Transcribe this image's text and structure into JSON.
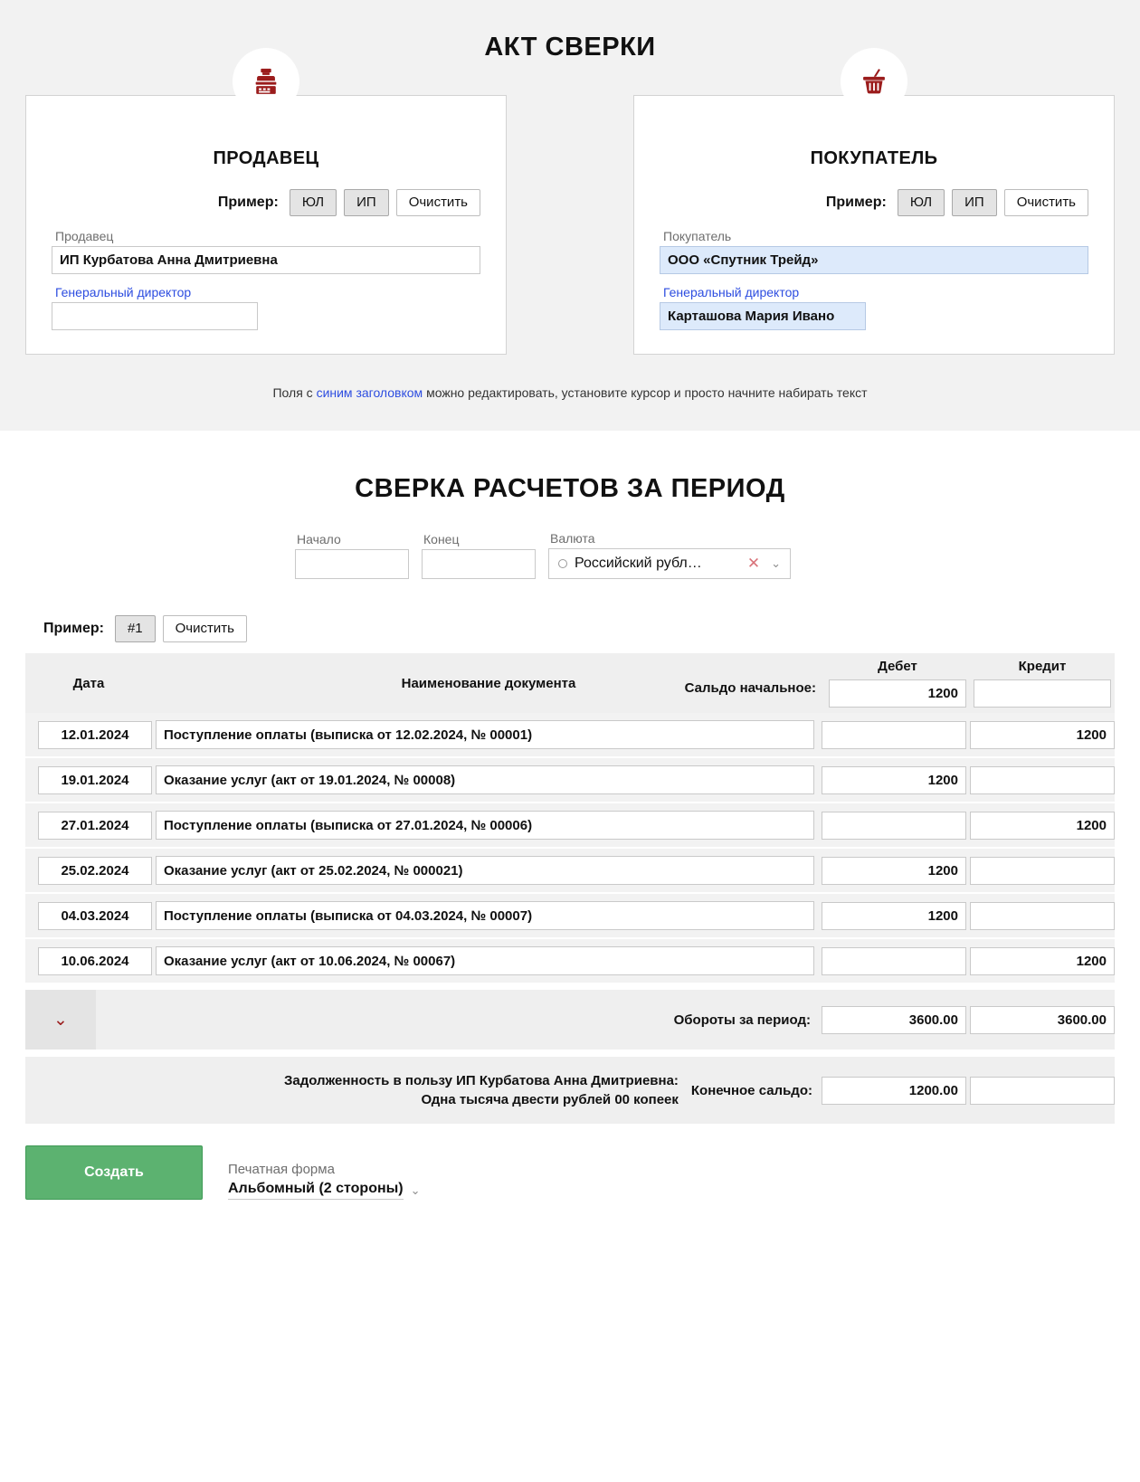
{
  "page_title": "АКТ СВЕРКИ",
  "colors": {
    "accent_red": "#9b1c1c",
    "link_blue": "#2d4de0",
    "create_green": "#5cb270",
    "highlight_blue": "#ddeafb",
    "panel_gray": "#f2f2f2"
  },
  "seller": {
    "badge_icon": "cash-register-icon",
    "title": "ПРОДАВЕЦ",
    "example_label": "Пример:",
    "btn_ul": "ЮЛ",
    "btn_ip": "ИП",
    "btn_clear": "Очистить",
    "name_label": "Продавец",
    "name_value": "ИП Курбатова Анна Дмитриевна",
    "role_label": "Генеральный директор",
    "role_value": ""
  },
  "buyer": {
    "badge_icon": "shopping-basket-icon",
    "title": "ПОКУПАТЕЛЬ",
    "example_label": "Пример:",
    "btn_ul": "ЮЛ",
    "btn_ip": "ИП",
    "btn_clear": "Очистить",
    "name_label": "Покупатель",
    "name_value": "ООО «Спутник Трейд»",
    "role_label": "Генеральный директор",
    "role_value": "Карташова Мария Ивано"
  },
  "hint": {
    "part1": "Поля с ",
    "blue": "синим заголовком",
    "part2": " можно редактировать, установите курсор и просто начните набирать текст"
  },
  "recon": {
    "title": "СВЕРКА РАСЧЕТОВ ЗА ПЕРИОД",
    "start_label": "Начало",
    "start_value": "",
    "end_label": "Конец",
    "end_value": "",
    "currency_label": "Валюта",
    "currency_value": "Российский рубл…",
    "clear_icon": "x-clear-icon",
    "chevron_icon": "chevron-down-icon",
    "example_label": "Пример:",
    "btn_example_1": "#1",
    "btn_clear": "Очистить"
  },
  "table": {
    "header": {
      "date": "Дата",
      "document": "Наименование документа",
      "debit": "Дебет",
      "credit": "Кредит",
      "opening_label": "Сальдо начальное:",
      "opening_debit": "1200",
      "opening_credit": ""
    },
    "rows": [
      {
        "date": "12.01.2024",
        "document": "Поступление оплаты (выписка от 12.02.2024, № 00001)",
        "debit": "",
        "credit": "1200"
      },
      {
        "date": "19.01.2024",
        "document": "Оказание услуг (акт от 19.01.2024, № 00008)",
        "debit": "1200",
        "credit": ""
      },
      {
        "date": "27.01.2024",
        "document": "Поступление оплаты (выписка от 27.01.2024, № 00006)",
        "debit": "",
        "credit": "1200"
      },
      {
        "date": "25.02.2024",
        "document": "Оказание услуг (акт от 25.02.2024, № 000021)",
        "debit": "1200",
        "credit": ""
      },
      {
        "date": "04.03.2024",
        "document": "Поступление оплаты (выписка от 04.03.2024, № 00007)",
        "debit": "1200",
        "credit": ""
      },
      {
        "date": "10.06.2024",
        "document": "Оказание услуг (акт от 10.06.2024, № 00067)",
        "debit": "",
        "credit": "1200"
      }
    ],
    "turnover": {
      "collapse_icon": "chevron-down-icon",
      "label": "Обороты за период:",
      "debit": "3600.00",
      "credit": "3600.00"
    },
    "final": {
      "debt_line1": "Задолженность в пользу ИП Курбатова Анна Дмитриевна:",
      "debt_line2": "Одна тысяча двести рублей 00 копеек",
      "label": "Конечное сальдо:",
      "debit": "1200.00",
      "credit": ""
    }
  },
  "footer": {
    "create_button": "Создать",
    "print_label": "Печатная форма",
    "print_value": "Альбомный (2 стороны)",
    "print_chevron_icon": "chevron-down-icon"
  }
}
